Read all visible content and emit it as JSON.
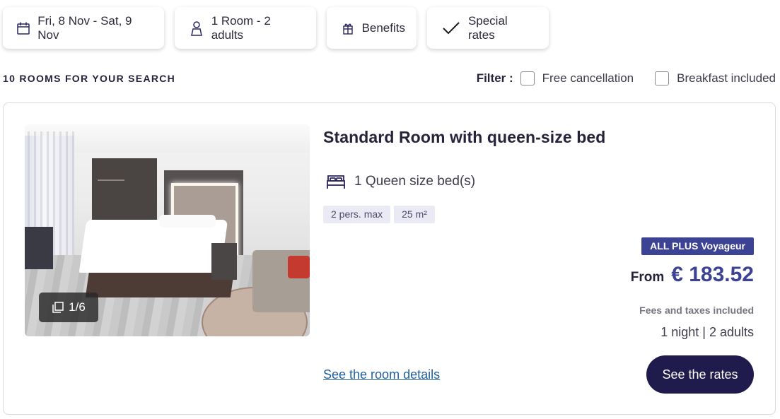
{
  "search_chips": {
    "dates": {
      "label": "Fri, 8 Nov - Sat, 9 Nov",
      "icon": "calendar-icon"
    },
    "occupancy": {
      "label": "1 Room - 2 adults",
      "icon": "person-icon"
    },
    "benefits": {
      "label": "Benefits",
      "icon": "gift-icon"
    },
    "special_rates": {
      "label": "Special rates",
      "icon": "checkmark-icon",
      "checked": true
    }
  },
  "results": {
    "count_label": "10 ROOMS FOR YOUR SEARCH"
  },
  "filter": {
    "label": "Filter :",
    "options": [
      {
        "label": "Free cancellation",
        "checked": false
      },
      {
        "label": "Breakfast included",
        "checked": false
      }
    ]
  },
  "room_card": {
    "title": "Standard Room with queen-size bed",
    "photo_counter": "1/6",
    "photo_alt": "Hotel room with queen-size bed",
    "bed": {
      "label": "1 Queen size bed(s)",
      "icon": "bed-icon"
    },
    "tags": [
      "2 pers. max",
      "25 m²"
    ],
    "loyalty_badge": "ALL PLUS Voyageur",
    "price_prefix": "From",
    "price": "€ 183.52",
    "fees_note": "Fees and taxes included",
    "stay_summary": "1 night | 2 adults",
    "details_link": "See the room details",
    "rates_button": "See the rates"
  },
  "colors": {
    "brand_navy": "#1f1b4d",
    "price_blue": "#3d4394",
    "link_blue": "#1f5f9b",
    "tag_bg": "#e9eaf4"
  }
}
